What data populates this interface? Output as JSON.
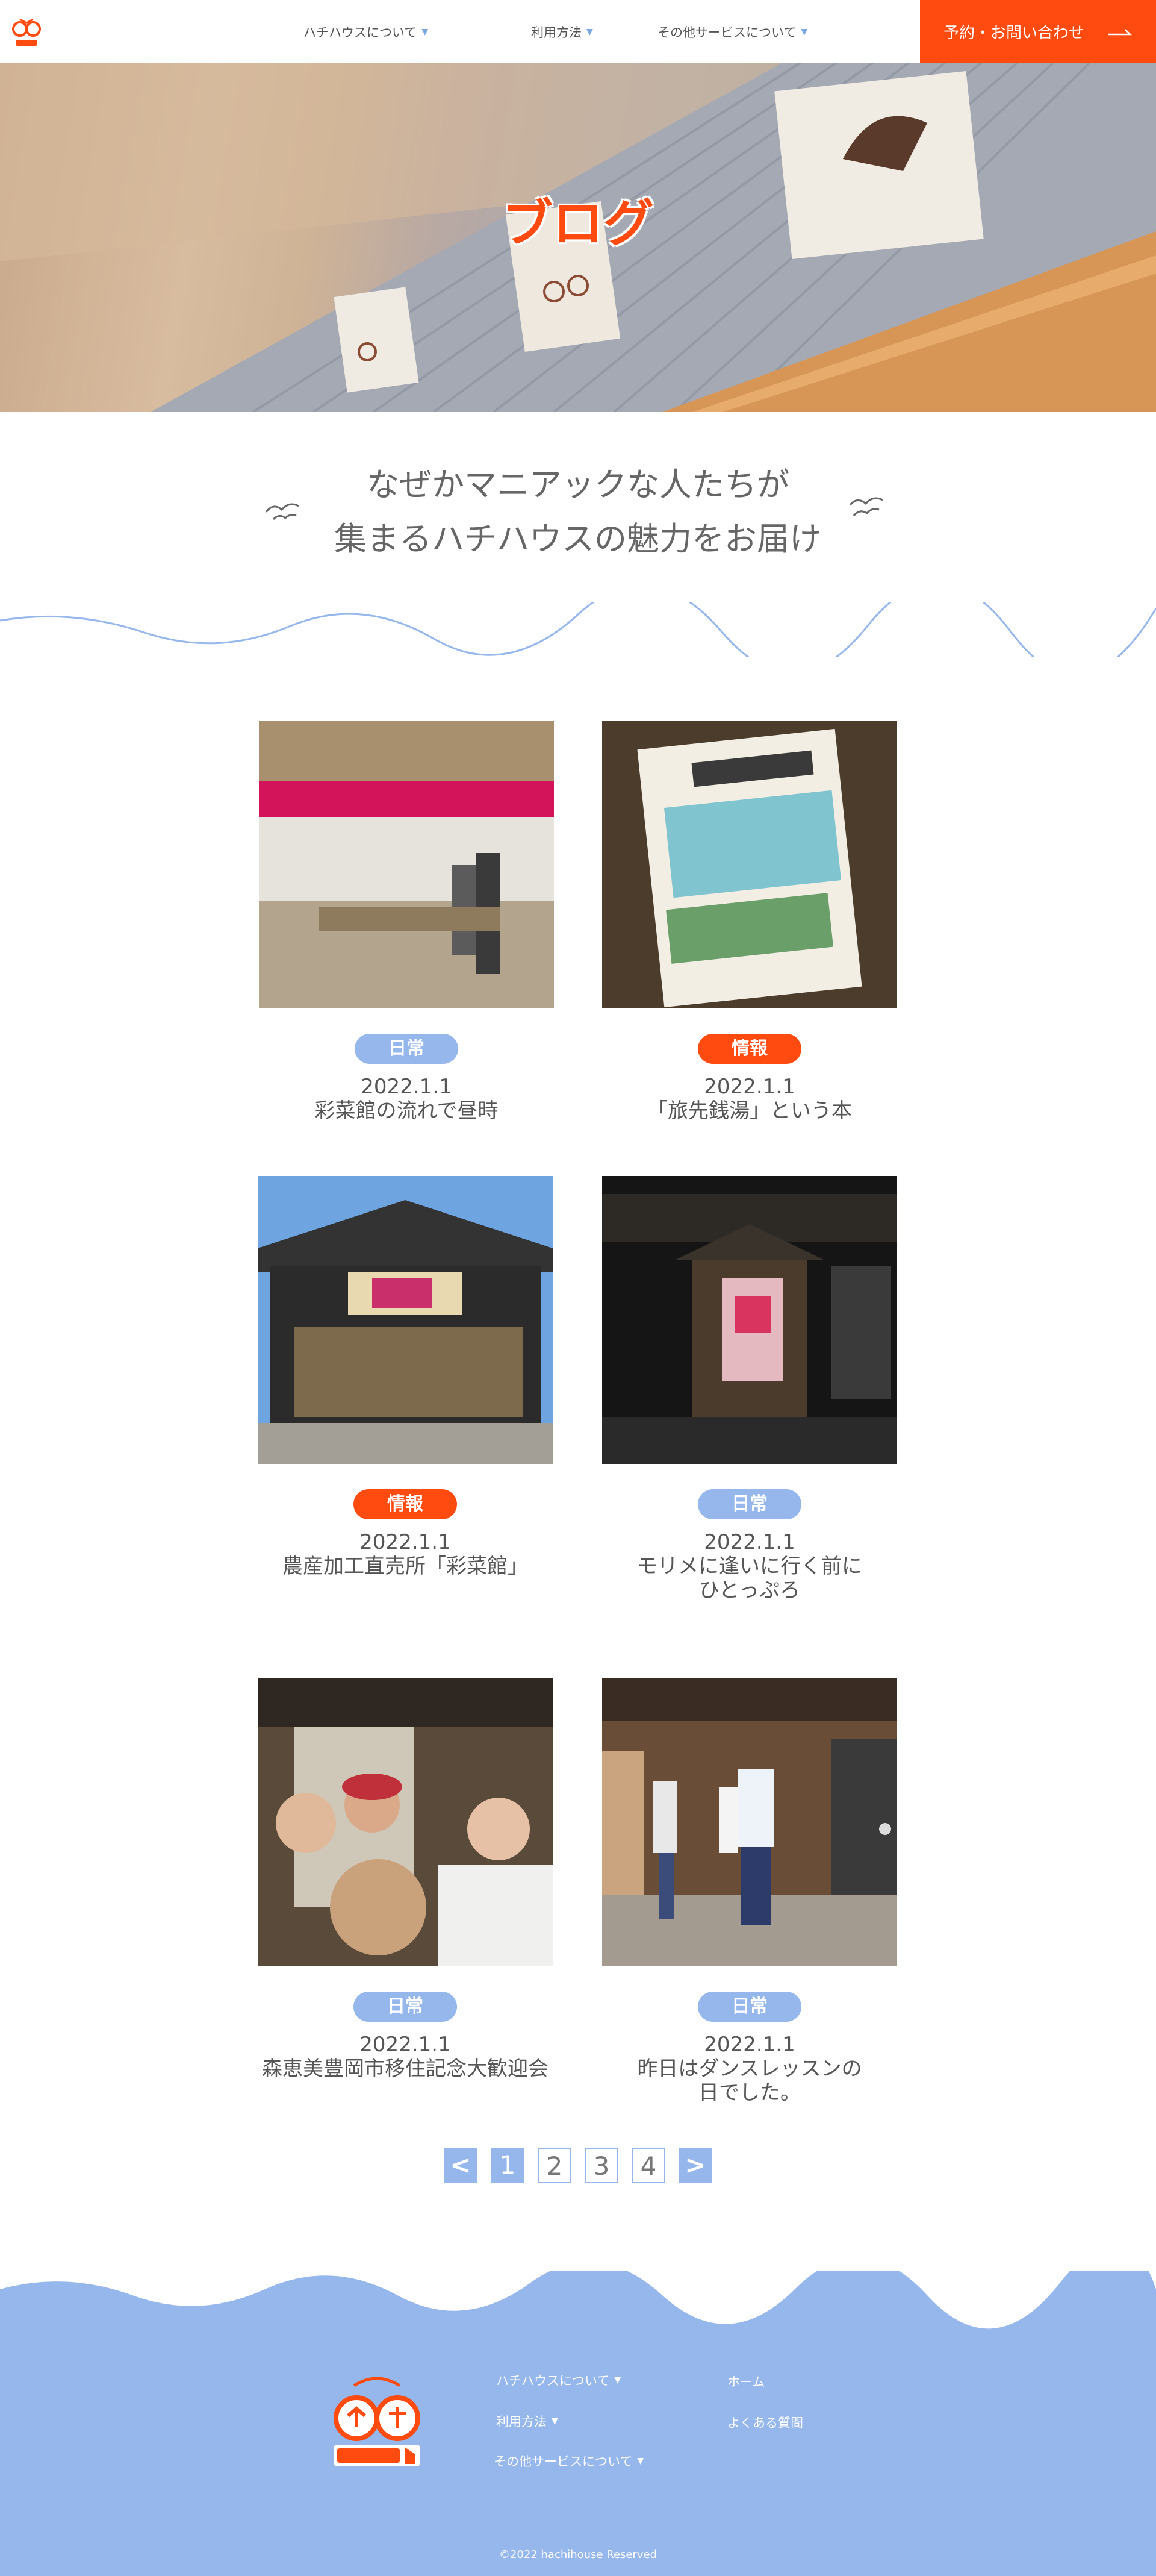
{
  "header": {
    "nav": [
      {
        "label": "ハチハウスについて",
        "has_dropdown": true
      },
      {
        "label": "利用方法",
        "has_dropdown": true
      },
      {
        "label": "その他サービスについて",
        "has_dropdown": true
      }
    ],
    "cta_label": "予約・お問い合わせ"
  },
  "hero": {
    "title": "ブログ"
  },
  "intro": {
    "line1": "なぜかマニアックな人たちが",
    "line2": "集まるハチハウスの魅力をお届け"
  },
  "posts": [
    {
      "category": "日常",
      "category_type": "daily",
      "date": "2022.1.1",
      "title_lines": [
        "彩菜館の流れで昼時"
      ],
      "image": "food-court-photo"
    },
    {
      "category": "情報",
      "category_type": "info",
      "date": "2022.1.1",
      "title_lines": [
        "「旅先銭湯」という本"
      ],
      "image": "book-photo"
    },
    {
      "category": "情報",
      "category_type": "info",
      "date": "2022.1.1",
      "title_lines": [
        "農産加工直売所「彩菜館」"
      ],
      "image": "shop-photo"
    },
    {
      "category": "日常",
      "category_type": "daily",
      "date": "2022.1.1",
      "title_lines": [
        "モリメに逢いに行く前に",
        "ひとっぷろ"
      ],
      "image": "bathhouse-photo"
    },
    {
      "category": "日常",
      "category_type": "daily",
      "date": "2022.1.1",
      "title_lines": [
        "森恵美豊岡市移住記念大歓迎会"
      ],
      "image": "party-photo"
    },
    {
      "category": "日常",
      "category_type": "daily",
      "date": "2022.1.1",
      "title_lines": [
        "昨日はダンスレッスンの",
        "日でした。"
      ],
      "image": "dance-photo"
    }
  ],
  "pagination": {
    "prev": "<",
    "pages": [
      "1",
      "2",
      "3",
      "4"
    ],
    "current": "1",
    "next": ">"
  },
  "footer": {
    "links_col1": [
      {
        "label": "ハチハウスについて",
        "has_dropdown": true
      },
      {
        "label": "利用方法",
        "has_dropdown": true
      },
      {
        "label": "その他サービスについて",
        "has_dropdown": true
      }
    ],
    "links_col2": [
      {
        "label": "ホーム"
      },
      {
        "label": "よくある質問"
      }
    ],
    "copyright": "©2022 hachihouse Reserved"
  },
  "colors": {
    "accent": "#ff4a10",
    "blue": "#95b7ec",
    "text": "#555555"
  }
}
